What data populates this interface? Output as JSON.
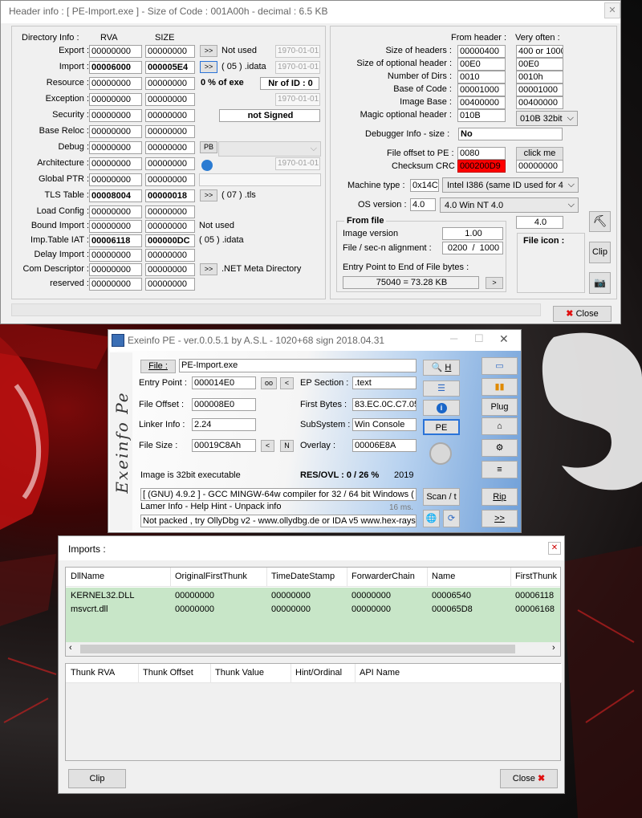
{
  "header_window": {
    "title": "Header info : [ PE-Import.exe ] - Size of Code : 001A00h - decimal : 6.5 KB",
    "col_dirinfo": "Directory Info :",
    "col_rva": "RVA",
    "col_size": "SIZE",
    "rows": [
      {
        "label": "Export :",
        "rva": "00000000",
        "size": "00000000",
        "bold": false,
        "has_btn": true,
        "btn": ">>",
        "note": "Not used",
        "date": "1970-01-01"
      },
      {
        "label": "Import :",
        "rva": "00006000",
        "size": "000005E4",
        "bold": true,
        "has_btn": true,
        "btn": ">>",
        "note": "( 05 ) .idata",
        "date": "1970-01-01"
      },
      {
        "label": "Resource :",
        "rva": "00000000",
        "size": "00000000",
        "bold": false,
        "has_btn": false,
        "btn": "",
        "note": "",
        "date": ""
      },
      {
        "label": "Exception :",
        "rva": "00000000",
        "size": "00000000",
        "bold": false,
        "has_btn": false,
        "btn": "",
        "note": "",
        "date": "1970-01-01"
      },
      {
        "label": "Security :",
        "rva": "00000000",
        "size": "00000000",
        "bold": false,
        "has_btn": false,
        "btn": "",
        "note": "",
        "date": ""
      },
      {
        "label": "Base Reloc :",
        "rva": "00000000",
        "size": "00000000",
        "bold": false,
        "has_btn": false,
        "btn": "",
        "note": "",
        "date": ""
      },
      {
        "label": "Debug :",
        "rva": "00000000",
        "size": "00000000",
        "bold": false,
        "has_btn": true,
        "btn": "PB",
        "note": "",
        "date": ""
      },
      {
        "label": "Architecture :",
        "rva": "00000000",
        "size": "00000000",
        "bold": false,
        "has_btn": false,
        "btn": "",
        "note": "",
        "date": "1970-01-01"
      },
      {
        "label": "Global PTR :",
        "rva": "00000000",
        "size": "00000000",
        "bold": false,
        "has_btn": false,
        "btn": "",
        "note": "",
        "date": ""
      },
      {
        "label": "TLS Table :",
        "rva": "00008004",
        "size": "00000018",
        "bold": true,
        "has_btn": true,
        "btn": ">>",
        "note": "( 07 ) .tls",
        "date": ""
      },
      {
        "label": "Load Config :",
        "rva": "00000000",
        "size": "00000000",
        "bold": false,
        "has_btn": false,
        "btn": "",
        "note": "",
        "date": ""
      },
      {
        "label": "Bound Import :",
        "rva": "00000000",
        "size": "00000000",
        "bold": false,
        "has_btn": false,
        "btn": "",
        "note": "Not used",
        "date": ""
      },
      {
        "label": "Imp.Table IAT :",
        "rva": "00006118",
        "size": "000000DC",
        "bold": true,
        "has_btn": false,
        "btn": "",
        "note": "( 05 ) .idata",
        "date": ""
      },
      {
        "label": "Delay Import :",
        "rva": "00000000",
        "size": "00000000",
        "bold": false,
        "has_btn": false,
        "btn": "",
        "note": "",
        "date": ""
      },
      {
        "label": "Com Descriptor :",
        "rva": "00000000",
        "size": "00000000",
        "bold": false,
        "has_btn": true,
        "btn": ">>",
        "note": ".NET Meta Directory",
        "date": ""
      },
      {
        "label": "reserved :",
        "rva": "00000000",
        "size": "00000000",
        "bold": false,
        "has_btn": false,
        "btn": "",
        "note": "",
        "date": ""
      }
    ],
    "resource_pct": "0  % of exe",
    "nr_of_id": "Nr of ID : 0",
    "not_signed": "not Signed",
    "from_header": "From header :",
    "very_often": "Very often :",
    "hdr_rows": [
      {
        "label": "Size of headers :",
        "value": "00000400",
        "often": "400 or 1000"
      },
      {
        "label": "Size of optional header :",
        "value": "00E0",
        "often": "00E0"
      },
      {
        "label": "Number of Dirs :",
        "value": "0010",
        "often": "0010h"
      },
      {
        "label": "Base of Code :",
        "value": "00001000",
        "often": "00001000"
      },
      {
        "label": "Image Base :",
        "value": "00400000",
        "often": "00400000"
      },
      {
        "label": "Magic optional header :",
        "value": "010B",
        "often": ""
      }
    ],
    "magic_select": "010B 32bit",
    "debugger_label": "Debugger Info  -  size :",
    "debugger_value": "No",
    "file_offset_label": "File offset to PE :",
    "file_offset_value": "0080",
    "click_me": "click me",
    "checksum_label": "Checksum CRC :",
    "checksum_value": "000200D9",
    "checksum_calc": "00000000",
    "machine_label": "Machine type :",
    "machine_value": "0x14C",
    "machine_select": "Intel I386 (same ID used for 4",
    "os_label": "OS version :",
    "os_value": "4.0",
    "os_select": "4.0   Win NT 4.0",
    "from_file": "From file",
    "ver_value": "4.0",
    "image_version_label": "Image version",
    "image_version_value": "1.00",
    "align_label": "File / sec-n alignment  :",
    "align_file": "0200",
    "align_sep": "/",
    "align_sec": "1000",
    "entry_label": "Entry Point to End of File bytes :",
    "entry_value": "75040  =  73.28 KB",
    "file_icon": "File icon :",
    "clip": "Clip",
    "close": "Close"
  },
  "exeinfo": {
    "title": "Exeinfo PE - ver.0.0.5.1  by A.S.L -  1020+68 sign  2018.04.31",
    "file_btn": "File :",
    "file_value": "PE-Import.exe",
    "ep_label": "Entry Point :",
    "ep_value": "000014E0",
    "oo": "oo",
    "lt": "<",
    "eps_label": "EP Section :",
    "eps_value": ".text",
    "fo_label": "File Offset :",
    "fo_value": "000008E0",
    "fb_label": "First Bytes :",
    "fb_value": "83.EC.0C.C7.05",
    "li_label": "Linker Info :",
    "li_value": "2.24",
    "ss_label": "SubSystem :",
    "ss_value": "Win Console",
    "fs_label": "File Size :",
    "fs_value": "00019C8Ah",
    "n": "N",
    "ov_label": "Overlay :",
    "ov_value": "00006E8A",
    "bits": "Image is 32bit executable",
    "resovl": "RES/OVL : 0 / 26 %",
    "year": "2019",
    "compiler": "[ (GNU) 4.9.2 ] - GCC MINGW-64w compiler for 32 / 64 bit Windows ( e",
    "lamer": "Lamer Info - Help Hint - Unpack info",
    "ms": "16 ms.",
    "packed": "Not packed , try OllyDbg v2 - www.ollydbg.de or IDA v5 www.hex-rays",
    "h_btn": "H",
    "pe_btn": "PE",
    "scan_btn": "Scan / t",
    "plug_btn": "Plug",
    "rip_btn": "Rip",
    "go_btn": ">>",
    "side_text": "Exeinfo Pe"
  },
  "imports": {
    "title": "Imports :",
    "cols": [
      "DllName",
      "OriginalFirstThunk",
      "TimeDateStamp",
      "ForwarderChain",
      "Name",
      "FirstThunk"
    ],
    "rows": [
      [
        "KERNEL32.DLL",
        "00000000",
        "00000000",
        "00000000",
        "00006540",
        "00006118"
      ],
      [
        "msvcrt.dll",
        "00000000",
        "00000000",
        "00000000",
        "000065D8",
        "00006168"
      ]
    ],
    "thunk_cols": [
      "Thunk RVA",
      "Thunk Offset",
      "Thunk Value",
      "Hint/Ordinal",
      "API Name"
    ],
    "clip": "Clip",
    "close": "Close"
  }
}
